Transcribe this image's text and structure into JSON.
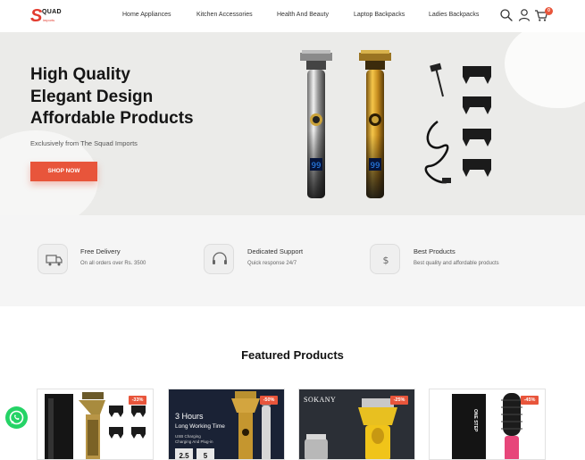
{
  "brand": {
    "mark": "S",
    "name": "QUAD",
    "sub": "imports"
  },
  "nav": {
    "items": [
      {
        "label": "Home Appliances"
      },
      {
        "label": "Kitchen Accessories"
      },
      {
        "label": "Health And Beauty"
      },
      {
        "label": "Laptop Backpacks"
      },
      {
        "label": "Ladies Backpacks"
      }
    ],
    "cart_count": "0"
  },
  "hero": {
    "title_line1": "High Quality",
    "title_line2": "Elegant Design",
    "title_line3": "Affordable Products",
    "subtitle": "Exclusively from The Squad Imports",
    "cta": "SHOP NOW",
    "display_digits": "99"
  },
  "features": [
    {
      "icon": "truck-icon",
      "title": "Free Delivery",
      "desc": "On all orders over Rs. 3500"
    },
    {
      "icon": "headset-icon",
      "title": "Dedicated Support",
      "desc": "Quick response 24/7"
    },
    {
      "icon": "dollar-icon",
      "title": "Best Products",
      "desc": "Best quality and affordable products"
    }
  ],
  "featured": {
    "title": "Featured Products",
    "products": [
      {
        "discount": "-33%"
      },
      {
        "discount": "-50%",
        "promo_line1": "3 Hours",
        "promo_line2": "Long Working Time",
        "promo_line3": "USB Charging",
        "promo_line4": "Charging And Plug-in",
        "spec1": "2.5",
        "spec2": "5"
      },
      {
        "discount": "-25%",
        "brand": "SOKANY"
      },
      {
        "discount": "-45%",
        "box_text": "ONE STEP"
      }
    ]
  },
  "colors": {
    "accent": "#e8553b",
    "whatsapp": "#25d366",
    "hero_bg": "#ebebe9"
  }
}
